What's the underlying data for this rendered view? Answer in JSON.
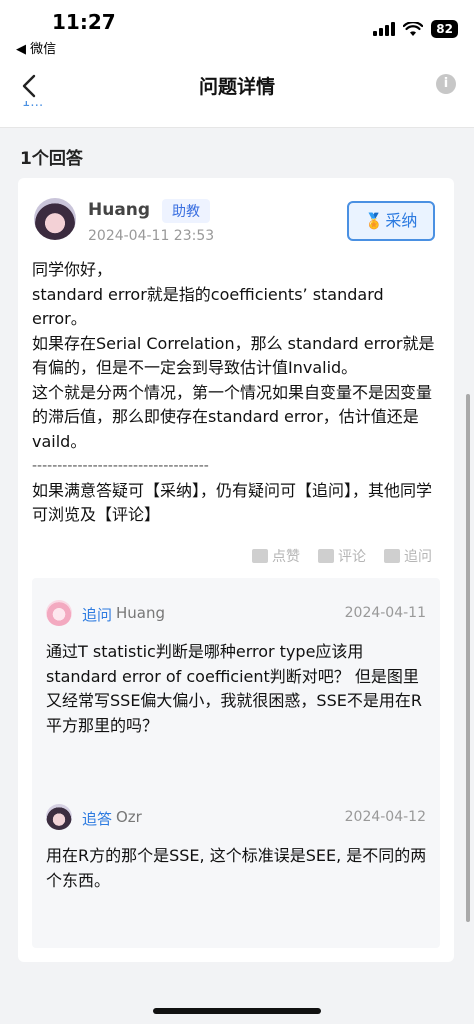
{
  "status_bar": {
    "time": "11:27",
    "back_app": "◀ 微信",
    "battery": "82"
  },
  "nav": {
    "title": "问题详情",
    "info": "i",
    "cut_text": "1…"
  },
  "answers": {
    "count_label": "1个回答",
    "items": [
      {
        "author": "Huang",
        "role": "助教",
        "date": "2024-04-11 23:53",
        "accept_label": "采纳",
        "body": [
          "同学你好，",
          "standard error就是指的coefficients’ standard error。",
          "如果存在Serial Correlation，那么 standard error就是有偏的，但是不一定会到导致估计值Invalid。",
          "这个就是分两个情况，第一个情况如果自变量不是因变量的滞后值，那么即使存在standard error，估计值还是vaild。",
          "-----------------------------------",
          "如果满意答疑可【采纳】，仍有疑问可【追问】，其他同学可浏览及【评论】"
        ],
        "actions": {
          "like": "点赞",
          "comment": "评论",
          "followup": "追问"
        },
        "followups": [
          {
            "type": "追问",
            "name": "Huang",
            "date": "2024-04-11",
            "text": "通过T statistic判断是哪种error type应该用 standard error of coefficient判断对吧？ 但是图里又经常写SSE偏大偏小，我就很困惑，SSE不是用在R平方那里的吗？"
          },
          {
            "type": "追答",
            "name": "Ozr",
            "date": "2024-04-12",
            "text": "用在R方的那个是SSE, 这个标准误是SEE, 是不同的两个东西。"
          }
        ]
      }
    ]
  },
  "colors": {
    "accent": "#2d7be0",
    "background": "#f2f3f5",
    "card": "#ffffff"
  }
}
